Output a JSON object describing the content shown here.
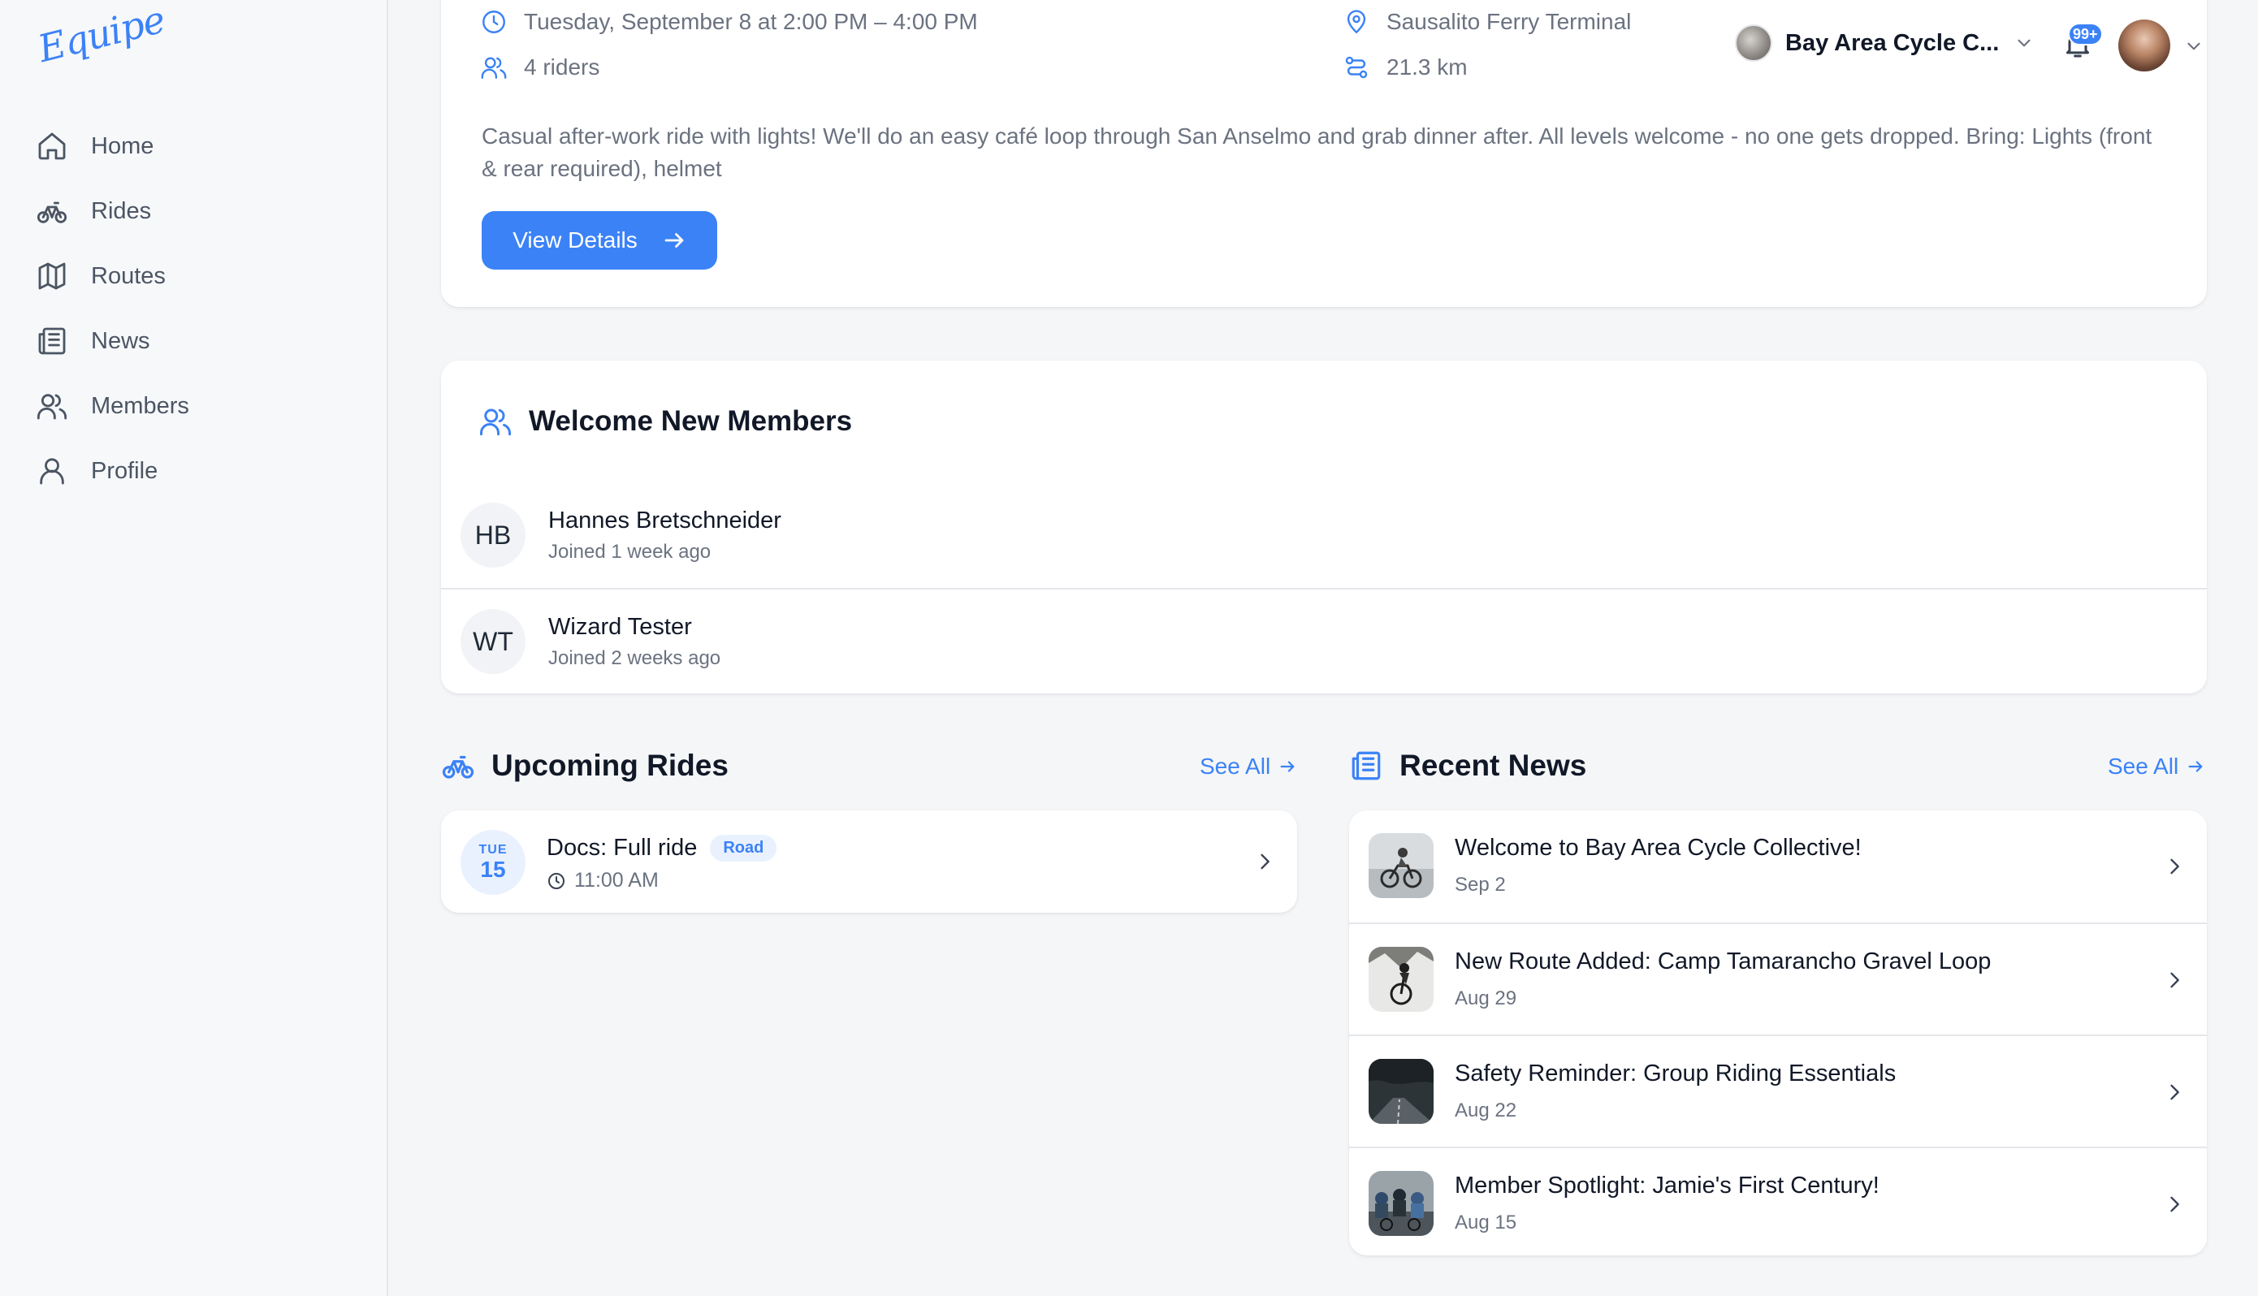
{
  "brand": {
    "logo_text": "Equipe"
  },
  "sidebar": {
    "items": [
      {
        "label": "Home",
        "icon": "home-icon"
      },
      {
        "label": "Rides",
        "icon": "bicycle-icon"
      },
      {
        "label": "Routes",
        "icon": "map-icon"
      },
      {
        "label": "News",
        "icon": "newspaper-icon"
      },
      {
        "label": "Members",
        "icon": "users-icon"
      },
      {
        "label": "Profile",
        "icon": "user-icon"
      }
    ]
  },
  "header": {
    "club_name": "Bay Area Cycle C...",
    "notification_count": "99+"
  },
  "featured_ride": {
    "datetime": "Tuesday, September 8 at 2:00 PM – 4:00 PM",
    "riders": "4 riders",
    "location": "Sausalito Ferry Terminal",
    "distance": "21.3 km",
    "description": "Casual after-work ride with lights! We'll do an easy café loop through San Anselmo and grab dinner after. All levels welcome - no one gets dropped. Bring: Lights (front & rear required), helmet",
    "button_label": "View Details"
  },
  "welcome_members": {
    "title": "Welcome New Members",
    "members": [
      {
        "initials": "HB",
        "name": "Hannes Bretschneider",
        "joined": "Joined 1 week ago"
      },
      {
        "initials": "WT",
        "name": "Wizard Tester",
        "joined": "Joined 2 weeks ago"
      }
    ]
  },
  "upcoming_rides": {
    "title": "Upcoming Rides",
    "see_all": "See All",
    "items": [
      {
        "dow": "TUE",
        "day": "15",
        "title": "Docs: Full ride",
        "tag": "Road",
        "time": "11:00 AM"
      }
    ]
  },
  "recent_news": {
    "title": "Recent News",
    "see_all": "See All",
    "items": [
      {
        "title": "Welcome to Bay Area Cycle Collective!",
        "date": "Sep 2"
      },
      {
        "title": "New Route Added: Camp Tamarancho Gravel Loop",
        "date": "Aug 29"
      },
      {
        "title": "Safety Reminder: Group Riding Essentials",
        "date": "Aug 22"
      },
      {
        "title": "Member Spotlight: Jamie's First Century!",
        "date": "Aug 15"
      }
    ]
  },
  "colors": {
    "accent": "#3b82f6",
    "text": "#111827",
    "muted": "#6b7280",
    "background": "#f5f6f8"
  }
}
